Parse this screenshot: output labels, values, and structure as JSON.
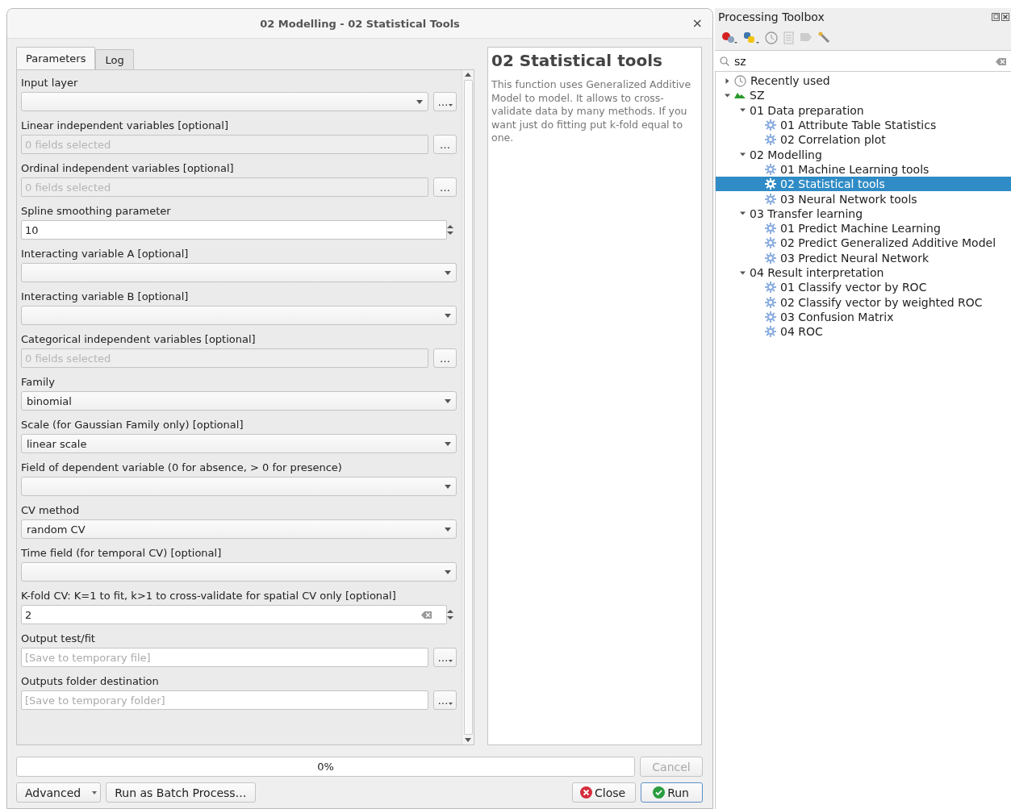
{
  "dialog": {
    "title": "02 Modelling - 02 Statistical Tools",
    "close": "×",
    "tabs": [
      {
        "label": "Parameters",
        "selected": true
      },
      {
        "label": "Log",
        "selected": false
      }
    ],
    "parameters": [
      {
        "label": "Input layer",
        "kind": "layer",
        "button": "…"
      },
      {
        "label": "Linear independent variables [optional]",
        "kind": "fields",
        "placeholder": "0 fields selected",
        "button": "…"
      },
      {
        "label": "Ordinal independent variables [optional]",
        "kind": "fields",
        "placeholder": "0 fields selected",
        "button": "…"
      },
      {
        "label": "Spline smoothing parameter",
        "kind": "number",
        "value": "10"
      },
      {
        "label": "Interacting variable A [optional]",
        "kind": "combo"
      },
      {
        "label": "Interacting variable B [optional]",
        "kind": "combo"
      },
      {
        "label": "Categorical independent variables [optional]",
        "kind": "fields",
        "placeholder": "0 fields selected",
        "button": "…"
      },
      {
        "label": "Family",
        "kind": "combo",
        "value": "binomial"
      },
      {
        "label": "Scale (for Gaussian Family only) [optional]",
        "kind": "combo",
        "value": "linear scale"
      },
      {
        "label": "Field of dependent variable (0 for absence, > 0 for presence)",
        "kind": "combo"
      },
      {
        "label": "CV method",
        "kind": "combo",
        "value": "random CV"
      },
      {
        "label": "Time field (for temporal CV) [optional]",
        "kind": "combo"
      },
      {
        "label": "K-fold CV: K=1 to fit, k>1 to cross-validate for spatial CV only [optional]",
        "kind": "number",
        "value": "2",
        "clearable": true
      },
      {
        "label": "Output test/fit",
        "kind": "file",
        "placeholder": "[Save to temporary file]",
        "button": "…"
      },
      {
        "label": "Outputs folder destination",
        "kind": "file",
        "placeholder": "[Save to temporary folder]",
        "button": "…"
      }
    ],
    "help": {
      "title": "02 Statistical tools",
      "text": "This function uses Generalized Additive Model to model. It allows to cross-validate data by many methods. If you want just do fitting put k-fold equal to one."
    },
    "progress": {
      "level": 0,
      "reading": "0%"
    },
    "cancel": {
      "label": "Cancel",
      "disabled": true
    },
    "buttons": [
      {
        "label": "Advanced",
        "kind": "menu"
      },
      {
        "label": "Run as Batch Process…",
        "kind": "plain"
      },
      {
        "label": "Close",
        "kind": "close"
      },
      {
        "label": "Run",
        "kind": "run"
      }
    ]
  },
  "toolbox": {
    "title": "Processing Toolbox",
    "search": {
      "value": "sz"
    },
    "tree": [
      {
        "label": "Recently used",
        "kind": "history",
        "expanded": false,
        "selected": false
      },
      {
        "label": "SZ",
        "kind": "provider",
        "expanded": true,
        "selected": false,
        "children": [
          {
            "label": "01 Data preparation",
            "expanded": true,
            "selected": false,
            "children": [
              {
                "label": "01 Attribute Table Statistics",
                "kind": "algorithm",
                "selected": false
              },
              {
                "label": "02 Correlation plot",
                "kind": "algorithm",
                "selected": false
              }
            ]
          },
          {
            "label": "02 Modelling",
            "expanded": true,
            "selected": false,
            "children": [
              {
                "label": "01 Machine Learning tools",
                "kind": "algorithm",
                "selected": false
              },
              {
                "label": "02 Statistical tools",
                "kind": "algorithm",
                "selected": true
              },
              {
                "label": "03 Neural Network tools",
                "kind": "algorithm",
                "selected": false
              }
            ]
          },
          {
            "label": "03 Transfer learning",
            "expanded": true,
            "selected": false,
            "children": [
              {
                "label": "01 Predict Machine Learning",
                "kind": "algorithm",
                "selected": false
              },
              {
                "label": "02 Predict Generalized Additive Model",
                "kind": "algorithm",
                "selected": false
              },
              {
                "label": "03 Predict Neural Network",
                "kind": "algorithm",
                "selected": false
              }
            ]
          },
          {
            "label": "04 Result interpretation",
            "expanded": true,
            "selected": false,
            "children": [
              {
                "label": "01 Classify vector by ROC",
                "kind": "algorithm",
                "selected": false
              },
              {
                "label": "02 Classify vector by weighted ROC",
                "kind": "algorithm",
                "selected": false
              },
              {
                "label": "03 Confusion Matrix",
                "kind": "algorithm",
                "selected": false
              },
              {
                "label": "04 ROC",
                "kind": "algorithm",
                "selected": false
              }
            ]
          }
        ]
      }
    ]
  }
}
